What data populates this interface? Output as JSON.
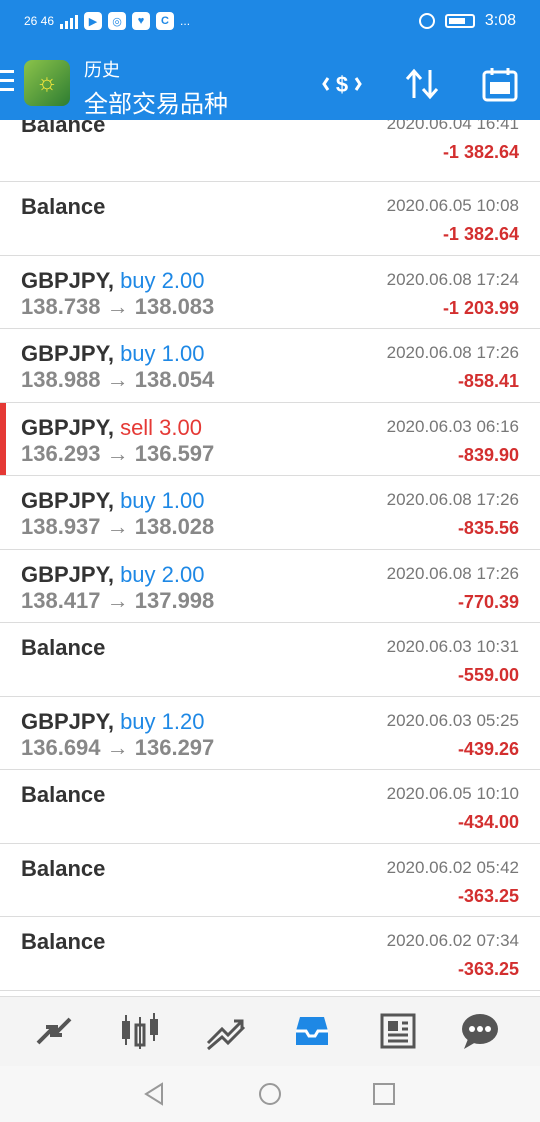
{
  "status_bar": {
    "left_text": "26 46",
    "misc": "...",
    "time": "3:08"
  },
  "header": {
    "subtitle": "历史",
    "title": "全部交易品种"
  },
  "icons": {
    "menu": "menu-icon",
    "exchange": "currency-exchange-icon",
    "sort": "sort-icon",
    "calendar": "calendar-icon"
  },
  "rows": [
    {
      "symbol": "Balance",
      "side": "",
      "prices": "",
      "time": "2020.06.04 16:41",
      "profit": "-1 382.64"
    },
    {
      "symbol": "Balance",
      "side": "",
      "prices": "",
      "time": "2020.06.05 10:08",
      "profit": "-1 382.64"
    },
    {
      "symbol": "GBPJPY,",
      "side": "buy 2.00",
      "prices": "138.738 → 138.083",
      "time": "2020.06.08 17:24",
      "profit": "-1 203.99"
    },
    {
      "symbol": "GBPJPY,",
      "side": "buy 1.00",
      "prices": "138.988 → 138.054",
      "time": "2020.06.08 17:26",
      "profit": "-858.41"
    },
    {
      "symbol": "GBPJPY,",
      "side": "sell 3.00",
      "prices": "136.293 → 136.597",
      "time": "2020.06.03 06:16",
      "profit": "-839.90"
    },
    {
      "symbol": "GBPJPY,",
      "side": "buy 1.00",
      "prices": "138.937 → 138.028",
      "time": "2020.06.08 17:26",
      "profit": "-835.56"
    },
    {
      "symbol": "GBPJPY,",
      "side": "buy 2.00",
      "prices": "138.417 → 137.998",
      "time": "2020.06.08 17:26",
      "profit": "-770.39"
    },
    {
      "symbol": "Balance",
      "side": "",
      "prices": "",
      "time": "2020.06.03 10:31",
      "profit": "-559.00"
    },
    {
      "symbol": "GBPJPY,",
      "side": "buy 1.20",
      "prices": "136.694 → 136.297",
      "time": "2020.06.03 05:25",
      "profit": "-439.26"
    },
    {
      "symbol": "Balance",
      "side": "",
      "prices": "",
      "time": "2020.06.05 10:10",
      "profit": "-434.00"
    },
    {
      "symbol": "Balance",
      "side": "",
      "prices": "",
      "time": "2020.06.02 05:42",
      "profit": "-363.25"
    },
    {
      "symbol": "Balance",
      "side": "",
      "prices": "",
      "time": "2020.06.02 07:34",
      "profit": "-363.25"
    }
  ],
  "tabs": [
    "quotes-icon",
    "chart-icon",
    "trade-icon",
    "history-icon",
    "news-icon",
    "chat-icon"
  ],
  "colors": {
    "accent": "#1e88e5",
    "loss": "#d32f2f",
    "sell": "#e53935"
  }
}
